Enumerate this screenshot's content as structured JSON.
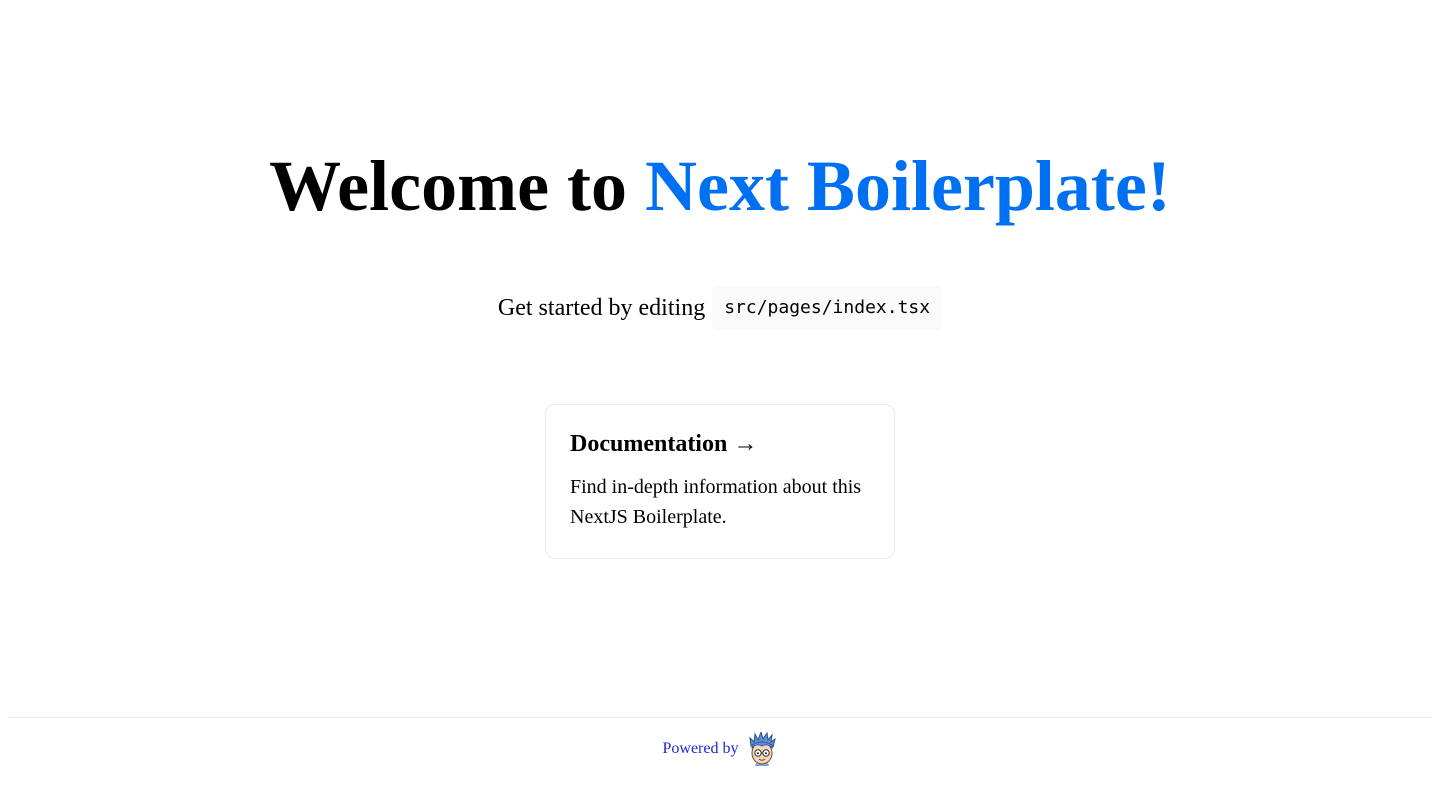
{
  "hero": {
    "title_prefix": "Welcome to",
    "title_accent": "Next Boilerplate!",
    "accent_color": "#0070f3"
  },
  "description": {
    "text": "Get started by editing",
    "code": "src/pages/index.tsx"
  },
  "card": {
    "title": "Documentation →",
    "body": "Find in-depth information about this NextJS Boilerplate."
  },
  "footer": {
    "powered_by": "Powered by",
    "logo_icon": "cartoon-face-logo-icon",
    "link_color": "#2222dd"
  }
}
